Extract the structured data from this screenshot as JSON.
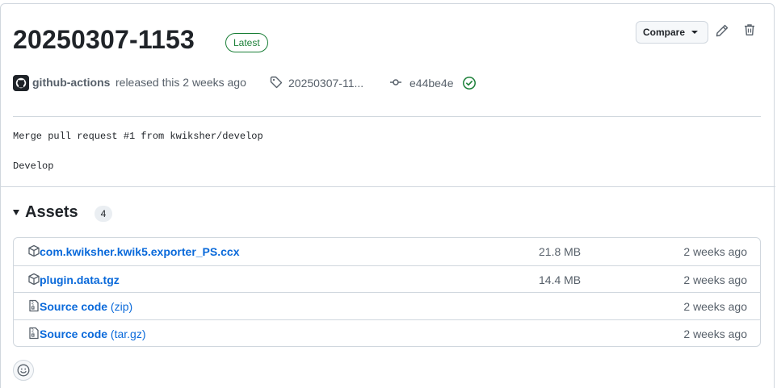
{
  "release": {
    "title": "20250307-1153",
    "badge": "Latest",
    "compare_label": "Compare",
    "author": "github-actions",
    "released_text": "released this 2 weeks ago",
    "tag": "20250307-11...",
    "commit": "e44be4e"
  },
  "body": {
    "line1": "Merge pull request #1 from kwiksher/develop",
    "line2": "Develop"
  },
  "assets": {
    "title": "Assets",
    "count": "4",
    "items": [
      {
        "name": "com.kwiksher.kwik5.exporter_PS.ccx",
        "suffix": "",
        "size": "21.8 MB",
        "date": "2 weeks ago",
        "icon": "package-icon"
      },
      {
        "name": "plugin.data.tgz",
        "suffix": "",
        "size": "14.4 MB",
        "date": "2 weeks ago",
        "icon": "package-icon"
      },
      {
        "name": "Source code",
        "suffix": "(zip)",
        "size": "",
        "date": "2 weeks ago",
        "icon": "file-zip-icon"
      },
      {
        "name": "Source code",
        "suffix": "(tar.gz)",
        "size": "",
        "date": "2 weeks ago",
        "icon": "file-zip-icon"
      }
    ]
  },
  "colors": {
    "link": "#0969da",
    "success": "#1a7f37",
    "muted": "#57606a",
    "border": "#d0d7de"
  }
}
